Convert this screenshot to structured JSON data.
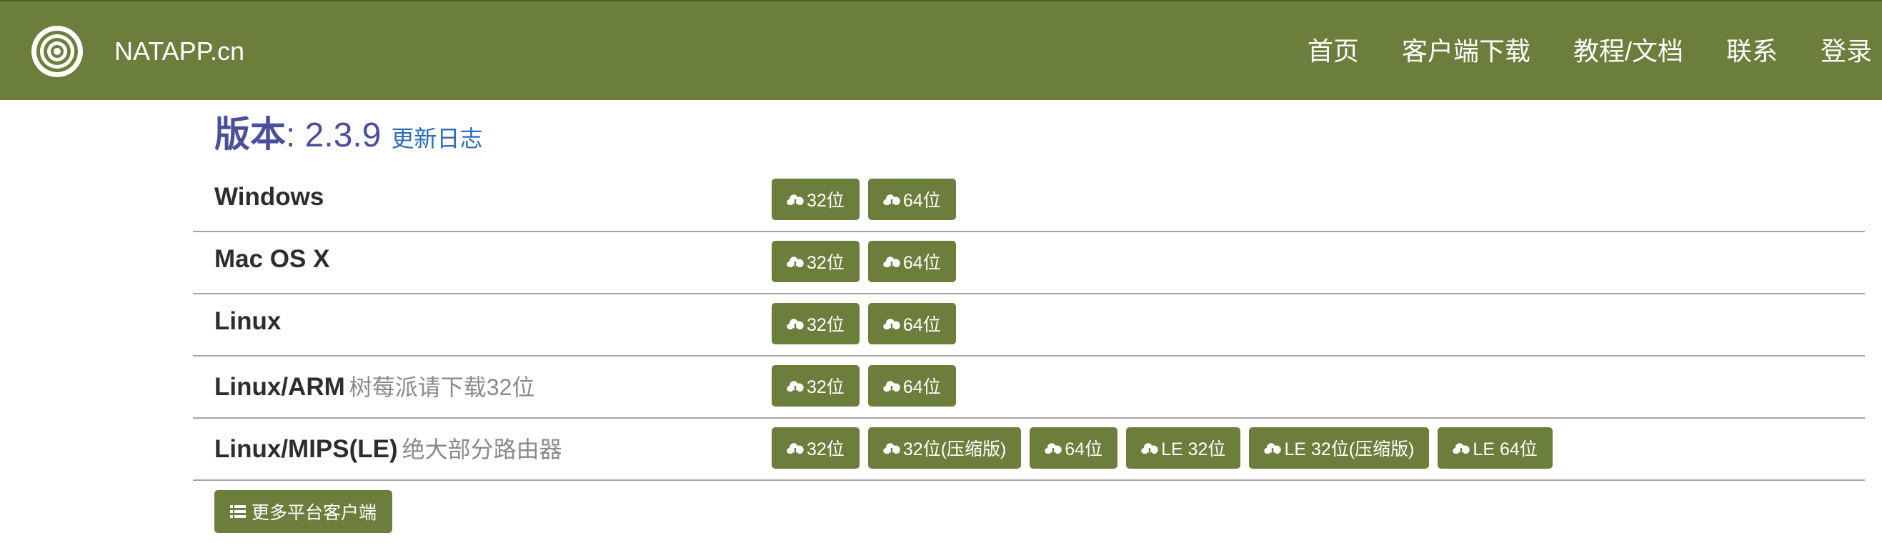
{
  "navbar": {
    "brand": "NATAPP.cn",
    "logo_icon": "concentric-circles-logo",
    "items": [
      "首页",
      "客户端下载",
      "教程/文档",
      "联系",
      "登录"
    ]
  },
  "version": {
    "label": "版本",
    "number": ": 2.3.9",
    "changelog": "更新日志"
  },
  "platforms": [
    {
      "name": "Windows",
      "note": "",
      "buttons": [
        "32位",
        "64位"
      ]
    },
    {
      "name": "Mac OS X",
      "note": "",
      "buttons": [
        "32位",
        "64位"
      ]
    },
    {
      "name": "Linux",
      "note": "",
      "buttons": [
        "32位",
        "64位"
      ]
    },
    {
      "name": "Linux/ARM",
      "note": "树莓派请下载32位",
      "buttons": [
        "32位",
        "64位"
      ]
    },
    {
      "name": "Linux/MIPS(LE)",
      "note": "绝大部分路由器",
      "buttons": [
        "32位",
        "32位(压缩版)",
        "64位",
        "LE 32位",
        "LE 32位(压缩版)",
        "LE 64位"
      ]
    }
  ],
  "more_button": {
    "label": "更多平台客户端",
    "icon": "list-icon"
  },
  "colors": {
    "accent": "#6b7e3c",
    "version_text": "#4a4e9c",
    "link": "#2d6bb6"
  }
}
